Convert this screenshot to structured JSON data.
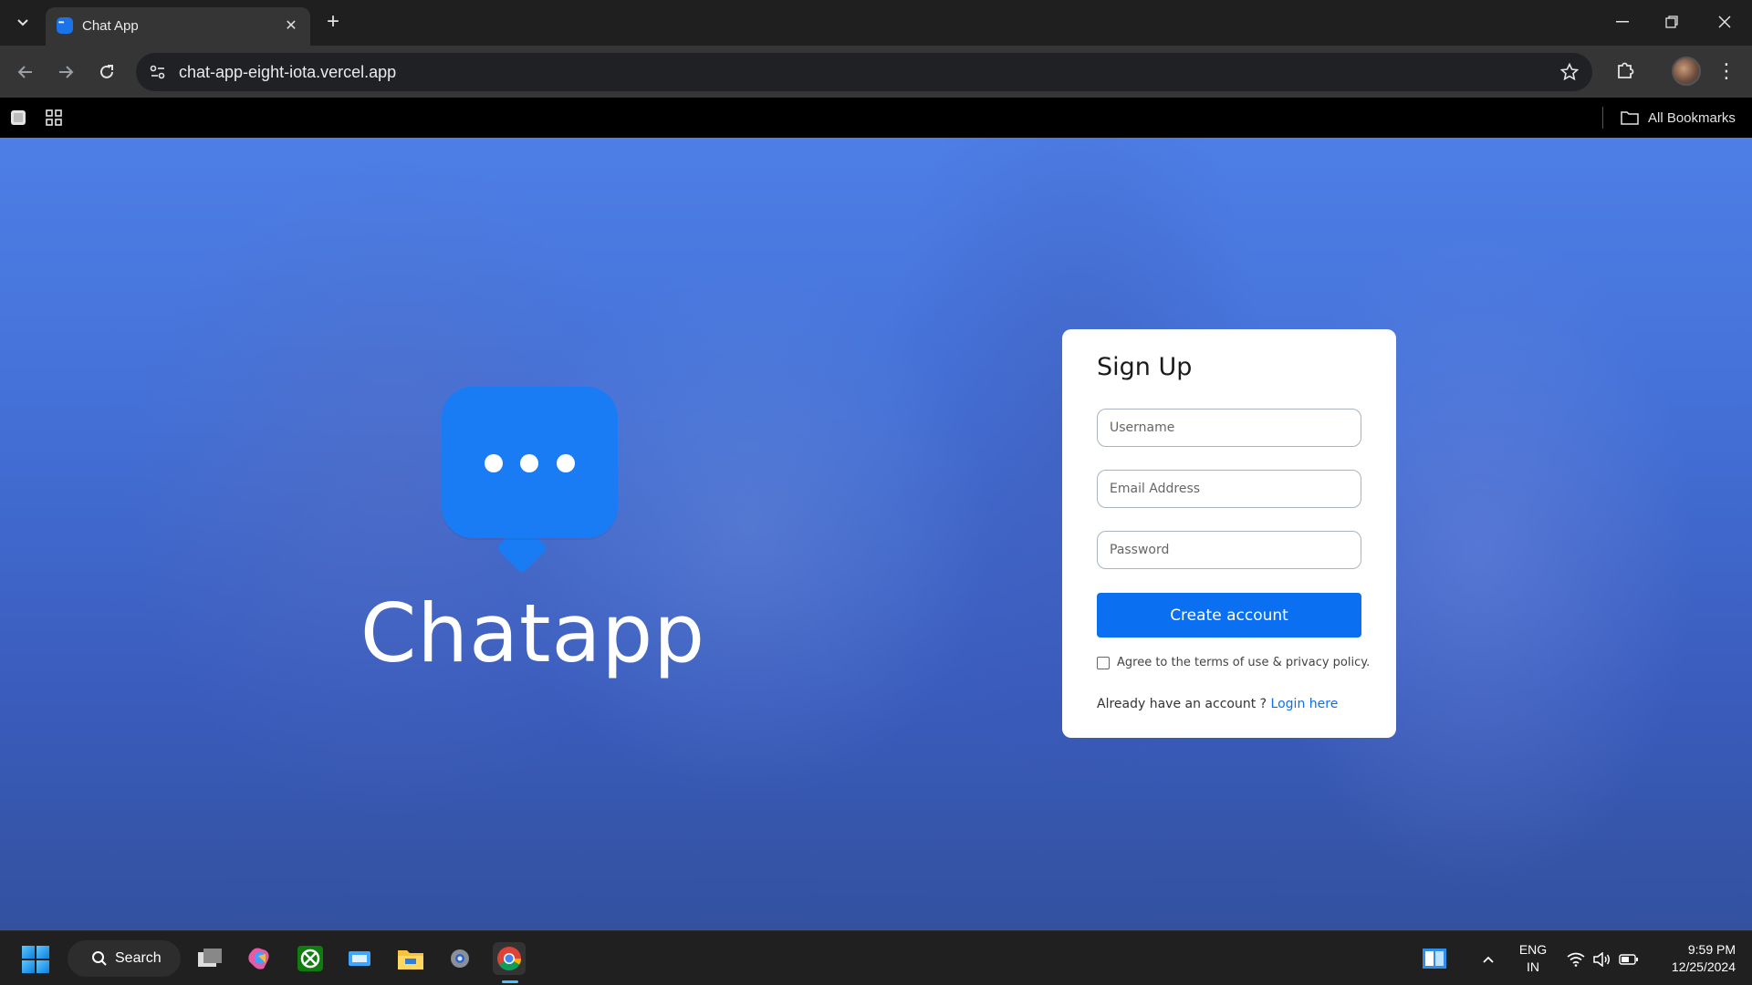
{
  "browser": {
    "tab_title": "Chat App",
    "url": "chat-app-eight-iota.vercel.app",
    "bookmarks_label": "All Bookmarks"
  },
  "page": {
    "brand_name": "Chatapp",
    "signup": {
      "title": "Sign Up",
      "username_placeholder": "Username",
      "email_placeholder": "Email Address",
      "password_placeholder": "Password",
      "submit_label": "Create account",
      "agree_label": "Agree to the terms of use & privacy policy.",
      "already_text": "Already have an account ?",
      "login_link": "Login here"
    }
  },
  "taskbar": {
    "search_label": "Search",
    "lang_top": "ENG",
    "lang_bottom": "IN",
    "time": "9:59 PM",
    "date": "12/25/2024"
  },
  "colors": {
    "accent": "#0a6ff0",
    "logo_bubble": "#1a7cf5"
  }
}
